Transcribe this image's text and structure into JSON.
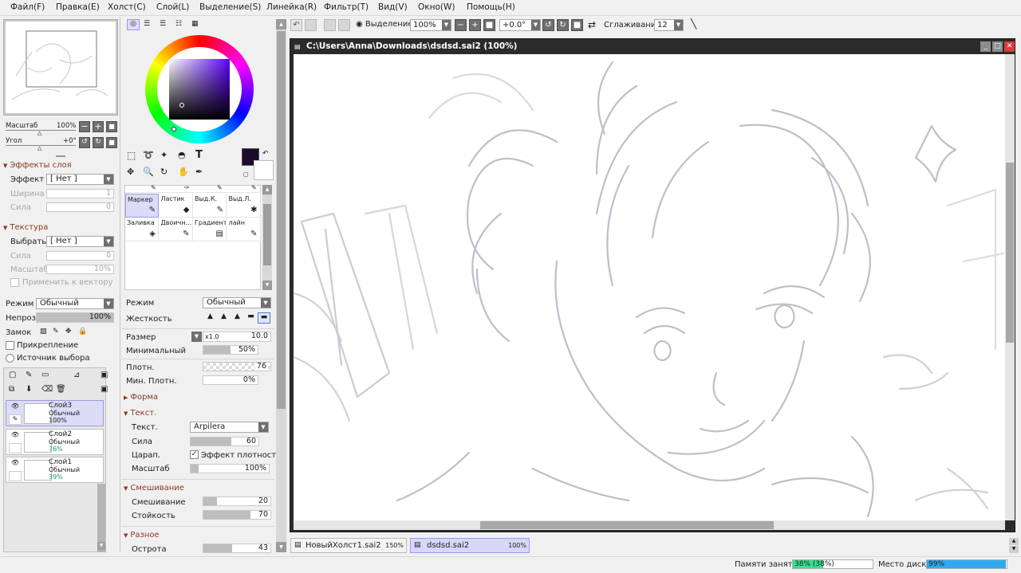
{
  "colors": {
    "accent_select": "#dcdcf7",
    "memory_fill": "#35e08f",
    "disk_fill": "#2ea9f0",
    "section_head": "#8b3a1f",
    "current_color": "#1e0a2a"
  },
  "menu": [
    "Файл(F)",
    "Правка(E)",
    "Холст(C)",
    "Слой(L)",
    "Выделение(S)",
    "Линейка(R)",
    "Фильтр(T)",
    "Вид(V)",
    "Окно(W)",
    "Помощь(H)"
  ],
  "toolbar": {
    "selection_label": "Выделение",
    "zoom": "100%",
    "rotation": "+0.0°",
    "smoothing_label": "Сглаживание",
    "smoothing_value": "12"
  },
  "navigator": {
    "zoom_label": "Масштаб",
    "zoom_value": "100%",
    "angle_label": "Угол",
    "angle_value": "+0°"
  },
  "layer_effects": {
    "title": "Эффекты слоя",
    "effect_label": "Эффект",
    "effect_value": "[ Нет ]",
    "width_label": "Ширина",
    "width_value": "1",
    "strength_label": "Сила",
    "strength_value": "0"
  },
  "texture": {
    "title": "Текстура",
    "select_label": "Выбрать",
    "select_value": "[ Нет ]",
    "strength_label": "Сила",
    "strength_value": "0",
    "scale_label": "Масштаб",
    "scale_value": "10%",
    "apply_label": "Применить к вектору"
  },
  "layer_props": {
    "mode_label": "Режим",
    "mode_value": "Обычный",
    "opacity_label": "Непроз.",
    "opacity_value": "100%",
    "opacity_fraction": 1.0,
    "lock_label": "Замок",
    "clip_label": "Прикрепление",
    "source_label": "Источник выбора"
  },
  "layers": [
    {
      "name": "Слой3",
      "mode": "Обычный",
      "opacity": "100%",
      "selected": true
    },
    {
      "name": "Слой2",
      "mode": "Обычный",
      "opacity": "76%",
      "selected": false
    },
    {
      "name": "Слой1",
      "mode": "Обычный",
      "opacity": "39%",
      "selected": false
    }
  ],
  "tools": [
    {
      "name": "Маркер",
      "icon": "marker-icon",
      "glyph": "✎"
    },
    {
      "name": "Ластик",
      "icon": "eraser-icon",
      "glyph": "◆"
    },
    {
      "name": "Выд.К.",
      "icon": "select-pen-icon",
      "glyph": "✎"
    },
    {
      "name": "Выд.Л.",
      "icon": "deselect-icon",
      "glyph": "✱"
    },
    {
      "name": "Заливка",
      "icon": "bucket-icon",
      "glyph": "◈"
    },
    {
      "name": "Двоичн...",
      "icon": "binary-pen-icon",
      "glyph": "✎"
    },
    {
      "name": "Градиент",
      "icon": "gradient-icon",
      "glyph": "▤"
    },
    {
      "name": "лайн",
      "icon": "liner-icon",
      "glyph": "✎"
    }
  ],
  "brush": {
    "mode_label": "Режим",
    "mode_value": "Обычный",
    "hardness_label": "Жесткость",
    "size_label": "Размер",
    "size_mult": "x1.0",
    "size_value": "10.0",
    "min_label": "Минимальный",
    "min_value": "50%",
    "min_fraction": 0.5,
    "density_label": "Плотн.",
    "density_value": "76",
    "min_density_label": "Мин. Плотн.",
    "min_density_value": "0%",
    "shape_title": "Форма",
    "texture_title": "Текст.",
    "texture_label": "Текст.",
    "texture_value": "Arpilera",
    "tex_strength_label": "Сила",
    "tex_strength_value": "60",
    "tex_strength_fraction": 0.6,
    "scratch_label": "Царап.",
    "density_effect_label": "Эффект плотности",
    "tex_scale_label": "Масштаб",
    "tex_scale_value": "100%",
    "tex_scale_fraction": 0.1,
    "mixing_title": "Смешивание",
    "blend_label": "Смешивание",
    "blend_value": "20",
    "blend_fraction": 0.2,
    "persistence_label": "Стойкость",
    "persistence_value": "70",
    "persistence_fraction": 0.7,
    "misc_title": "Разное",
    "sharpness_label": "Острота",
    "sharpness_value": "43",
    "sharpness_fraction": 0.43
  },
  "document": {
    "title": "C:\\Users\\Anna\\Downloads\\dsdsd.sai2 (100%)"
  },
  "tabs": [
    {
      "name": "НовыйХолст1.sai2",
      "zoom": "150%",
      "active": false
    },
    {
      "name": "dsdsd.sai2",
      "zoom": "100%",
      "active": true
    }
  ],
  "status": {
    "memory_label": "Памяти занято",
    "memory_value": "38% (38%)",
    "memory_fraction": 0.38,
    "disk_label": "Место диска",
    "disk_value": "99%",
    "disk_fraction": 0.99
  }
}
